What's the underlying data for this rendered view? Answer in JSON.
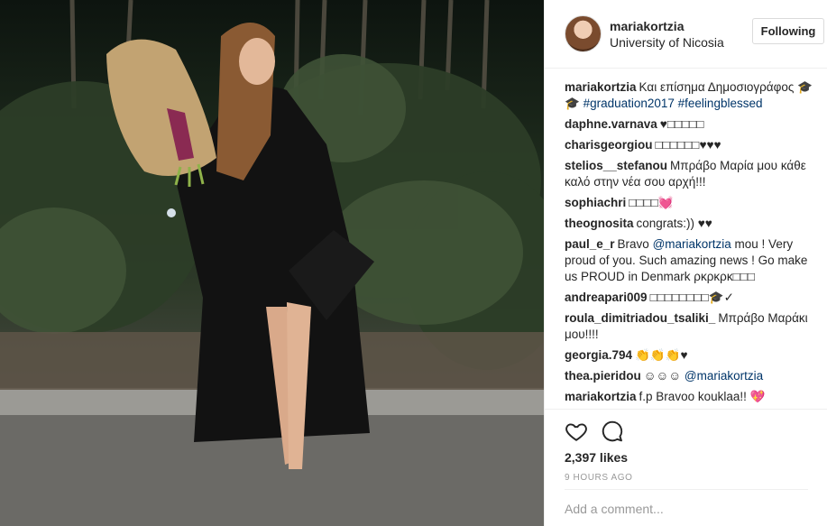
{
  "header": {
    "username": "mariakortzia",
    "location": "University of Nicosia",
    "follow_label": "Following"
  },
  "comments": [
    {
      "user": "mariakortzia",
      "text": "Και επίσημα Δημοσιογράφος 🎓🎓",
      "tags": " #graduation2017 #feelingblessed"
    },
    {
      "user": "daphne.varnava",
      "text": "♥□□□□□",
      "tags": ""
    },
    {
      "user": "charisgeorgiou",
      "text": "□□□□□□♥♥♥",
      "tags": ""
    },
    {
      "user": "stelios__stefanou",
      "text": "Μπράβο Μαρία μου κάθε καλό στην νέα σου αρχή!!!",
      "tags": ""
    },
    {
      "user": "sophiachri",
      "text": "□□□□💓",
      "tags": ""
    },
    {
      "user": "theognosita",
      "text": "congrats:)) ♥♥",
      "tags": ""
    },
    {
      "user": "paul_e_r",
      "text": "Bravo ",
      "tags": "@mariakortzia",
      "text2": " mou ! Very proud of you. Such amazing news ! Go make us PROUD in Denmark ρκρκρκ□□□"
    },
    {
      "user": "andreapari009",
      "text": "□□□□□□□□🎓✓",
      "tags": ""
    },
    {
      "user": "roula_dimitriadou_tsaliki_",
      "text": "Μπράβο Μαράκι μου!!!!",
      "tags": ""
    },
    {
      "user": "georgia.794",
      "text": "👏👏👏♥",
      "tags": ""
    },
    {
      "user": "thea.pieridou",
      "text": "☺☺☺ ",
      "tags": "@mariakortzia"
    },
    {
      "user": "mariakortzia",
      "text": "f.p Bravoo kouklaa!! 💖",
      "tags": ""
    }
  ],
  "actions": {
    "like_icon": "heart-outline-icon",
    "comment_icon": "speech-bubble-icon",
    "likes": "2,397 likes",
    "time": "9 HOURS AGO",
    "add_comment_placeholder": "Add a comment..."
  }
}
